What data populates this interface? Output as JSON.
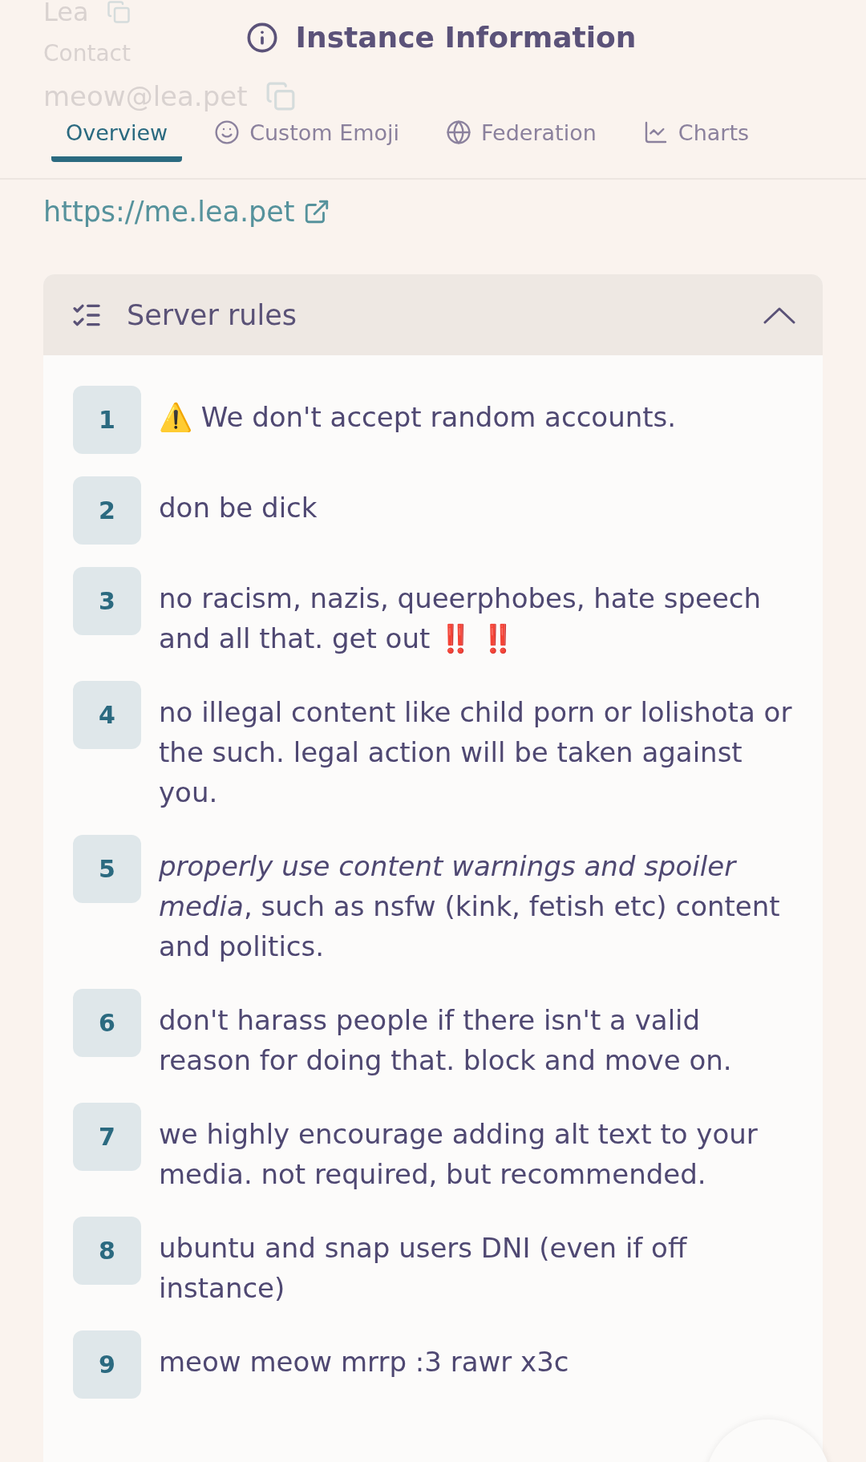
{
  "background_content": {
    "name": "Lea",
    "contact_label": "Contact",
    "email": "meow@lea.pet"
  },
  "title": "Instance Information",
  "tabs": [
    {
      "label": "Overview",
      "selected": true
    },
    {
      "label": "Custom Emoji",
      "selected": false
    },
    {
      "label": "Federation",
      "selected": false
    },
    {
      "label": "Charts",
      "selected": false
    }
  ],
  "website_link": "https://me.lea.pet",
  "rules_panel": {
    "title": "Server rules",
    "expanded": true,
    "rules": [
      {
        "number": "1",
        "text": "⚠️ We don't accept random accounts."
      },
      {
        "number": "2",
        "text": "don be dick"
      },
      {
        "number": "3",
        "text": "no racism, nazis, queerphobes, hate speech and all that. get out ‼️ ‼️"
      },
      {
        "number": "4",
        "text": "no illegal content like child porn or lolishota or the such. legal action will be taken against you."
      },
      {
        "number": "5",
        "text": "*properly use content warnings and spoiler media*, such as nsfw (kink, fetish etc) content and politics."
      },
      {
        "number": "6",
        "text": "don't harass people if there isn't a valid reason for doing that. block and move on."
      },
      {
        "number": "7",
        "text": "we highly encourage adding alt text to your media. not required, but recommended."
      },
      {
        "number": "8",
        "text": "ubuntu and snap users DNI (even if off instance)"
      },
      {
        "number": "9",
        "text": "meow meow mrrp :3 rawr x3c"
      }
    ]
  }
}
